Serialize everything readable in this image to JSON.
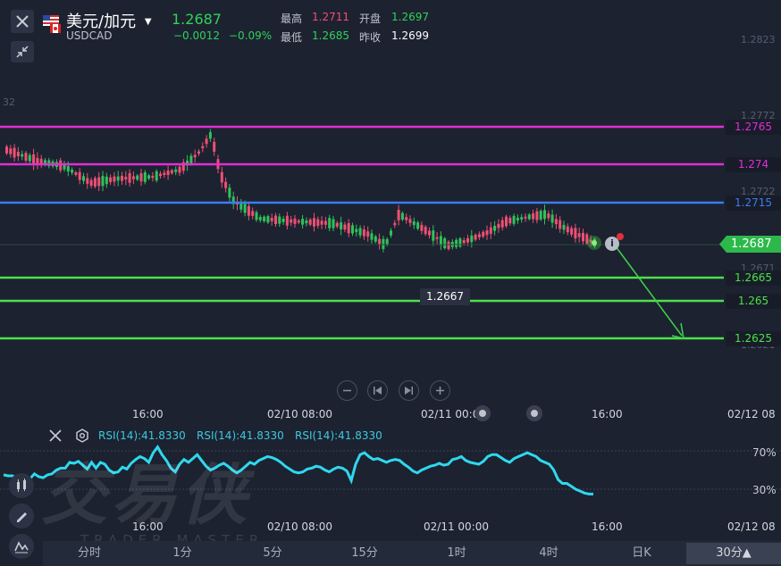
{
  "header": {
    "symbol_name": "美元/加元",
    "symbol_code": "USDCAD",
    "price": "1.2687",
    "change": "−0.0012",
    "change_pct": "−0.09%",
    "high_label": "最高",
    "high_value": "1.2711",
    "open_label": "开盘",
    "open_value": "1.2697",
    "low_label": "最低",
    "low_value": "1.2685",
    "prev_close_label": "昨收",
    "prev_close_value": "1.2699"
  },
  "price_axis": {
    "ticks": [
      "1.2823",
      "1.2772",
      "1.2722",
      "1.2671",
      "1.2621",
      "32"
    ]
  },
  "levels": [
    {
      "value": "1.2765",
      "color": "#e02ed6"
    },
    {
      "value": "1.274",
      "color": "#e02ed6"
    },
    {
      "value": "1.2715",
      "color": "#3d7cf0"
    },
    {
      "value": "1.2665",
      "color": "#4ee04a"
    },
    {
      "value": "1.265",
      "color": "#4ee04a"
    },
    {
      "value": "1.2625",
      "color": "#4ee04a"
    }
  ],
  "current_price_tag": "1.2687",
  "low_marker": "1.2667",
  "time_axis": [
    "16:00",
    "02/10 08:00",
    "02/11 00:00",
    "16:00",
    "02/12 08"
  ],
  "rsi": {
    "labels": [
      "RSI(14):41.8330",
      "RSI(14):41.8330",
      "RSI(14):41.8330"
    ],
    "levels": [
      "70%",
      "30%"
    ],
    "values": [
      45,
      44,
      44,
      42,
      43,
      44,
      41,
      46,
      43,
      42,
      45,
      46,
      50,
      52,
      52,
      58,
      57,
      59,
      55,
      51,
      58,
      52,
      58,
      56,
      50,
      47,
      48,
      53,
      51,
      57,
      61,
      64,
      62,
      58,
      68,
      74,
      66,
      60,
      52,
      48,
      56,
      61,
      58,
      62,
      66,
      60,
      54,
      50,
      52,
      55,
      57,
      54,
      50,
      47,
      50,
      54,
      58,
      56,
      60,
      62,
      64,
      63,
      61,
      58,
      54,
      51,
      48,
      47,
      48,
      51,
      52,
      54,
      53,
      50,
      48,
      51,
      53,
      52,
      49,
      39,
      56,
      66,
      68,
      64,
      61,
      62,
      60,
      58,
      60,
      61,
      60,
      56,
      53,
      49,
      47,
      50,
      52,
      54,
      55,
      57,
      55,
      56,
      61,
      62,
      64,
      60,
      58,
      57,
      56,
      59,
      64,
      66,
      66,
      63,
      60,
      58,
      62,
      64,
      66,
      68,
      66,
      64,
      60,
      58,
      56,
      50,
      40,
      36,
      36,
      33,
      30,
      28,
      26,
      25,
      25
    ]
  },
  "rsi_time_axis": [
    "16:00",
    "02/10 08:00",
    "02/11 00:00",
    "16:00",
    "02/12 08"
  ],
  "nav_controls": [
    "zoom-out",
    "prev",
    "next",
    "zoom-in"
  ],
  "watermark": {
    "big": "交易侠",
    "small": "TRADER MASTER"
  },
  "timeframes": [
    "分时",
    "1分",
    "5分",
    "15分",
    "1时",
    "4时",
    "日K",
    "30分▲"
  ],
  "active_timeframe": "30分▲"
}
